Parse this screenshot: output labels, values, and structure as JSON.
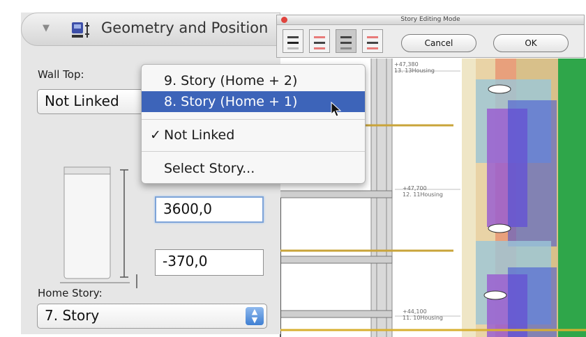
{
  "panel": {
    "header_title": "Geometry and Position",
    "wall_top_label": "Wall Top:",
    "wall_top_value": "Not Linked",
    "height_value": "3600,0",
    "offset_value": "-370,0",
    "home_story_label": "Home Story:",
    "home_story_value": "7. Story"
  },
  "dropdown": {
    "items": [
      {
        "label": "9. Story (Home + 2)",
        "selected": false,
        "checked": false
      },
      {
        "label": "8. Story (Home + 1)",
        "selected": true,
        "checked": false
      },
      {
        "label": "Not Linked",
        "selected": false,
        "checked": true
      },
      {
        "label": "Select Story...",
        "selected": false,
        "checked": false
      }
    ],
    "check_glyph": "✓"
  },
  "story_editing_dialog": {
    "title": "Story Editing Mode",
    "cancel_label": "Cancel",
    "ok_label": "OK",
    "mode_buttons": [
      "mode-1-icon",
      "mode-2-icon",
      "mode-3-icon",
      "mode-4-icon"
    ]
  },
  "drawing": {
    "elevations": [
      {
        "level": "+47,380",
        "story": "13. 13Housing"
      },
      {
        "level": "+47,700",
        "story": "12. 11Housing"
      },
      {
        "level": "+44,100",
        "story": "11. 10Housing"
      }
    ]
  },
  "colors": {
    "selection": "#3d64b9",
    "focus_ring": "#7ea4d8",
    "slab_line": "#c9a43a",
    "story_tag_red": "#e87b79"
  }
}
